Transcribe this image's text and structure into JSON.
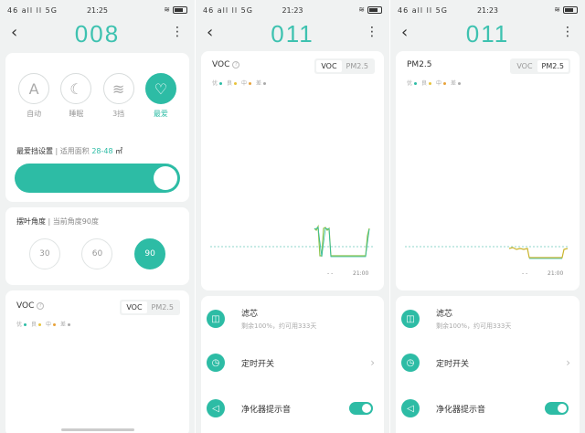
{
  "status": {
    "signal": "46 all ll 5G",
    "time_p1": "21:25",
    "time_p2": "21:23",
    "time_p3": "21:23"
  },
  "panel1": {
    "title": "008",
    "modes": [
      {
        "icon": "A",
        "label": "自动"
      },
      {
        "icon": "moon-icon",
        "label": "睡眠"
      },
      {
        "icon": "wind-icon",
        "label": "3挡"
      },
      {
        "icon": "heart-icon",
        "label": "最爱",
        "active": true
      }
    ],
    "fav_setting": "最爱挡设置",
    "area_prefix": "适用面积",
    "area_value": "28-48",
    "area_unit": "㎡",
    "swing_title": "摆叶角度",
    "swing_sub": "当前角度90度",
    "angles": [
      "30",
      "60",
      "90"
    ],
    "active_angle": "90",
    "voc_title": "VOC",
    "seg_voc": "VOC",
    "seg_pm": "PM2.5"
  },
  "panel2": {
    "title": "011",
    "chart_title": "VOC",
    "seg_voc": "VOC",
    "seg_pm": "PM2.5",
    "x_tick_left": "- -",
    "x_tick_right": "21:00",
    "filter_title": "滤芯",
    "filter_sub": "剩余100%，约可用333天",
    "timer_title": "定时开关",
    "sound_title": "净化器提示音"
  },
  "panel3": {
    "title": "011",
    "chart_title": "PM2.5",
    "seg_voc": "VOC",
    "seg_pm": "PM2.5",
    "x_tick_left": "- -",
    "x_tick_right": "21:00",
    "filter_title": "滤芯",
    "filter_sub": "剩余100%，约可用333天",
    "timer_title": "定时开关",
    "sound_title": "净化器提示音"
  },
  "legend": [
    {
      "label": "优",
      "color": "#2dbca5"
    },
    {
      "label": "良",
      "color": "#e8c33a"
    },
    {
      "label": "中",
      "color": "#e8a23a"
    },
    {
      "label": "差",
      "color": "#aaaaaa"
    }
  ],
  "colors": {
    "accent": "#2dbca5",
    "title": "#3ec2b0"
  }
}
